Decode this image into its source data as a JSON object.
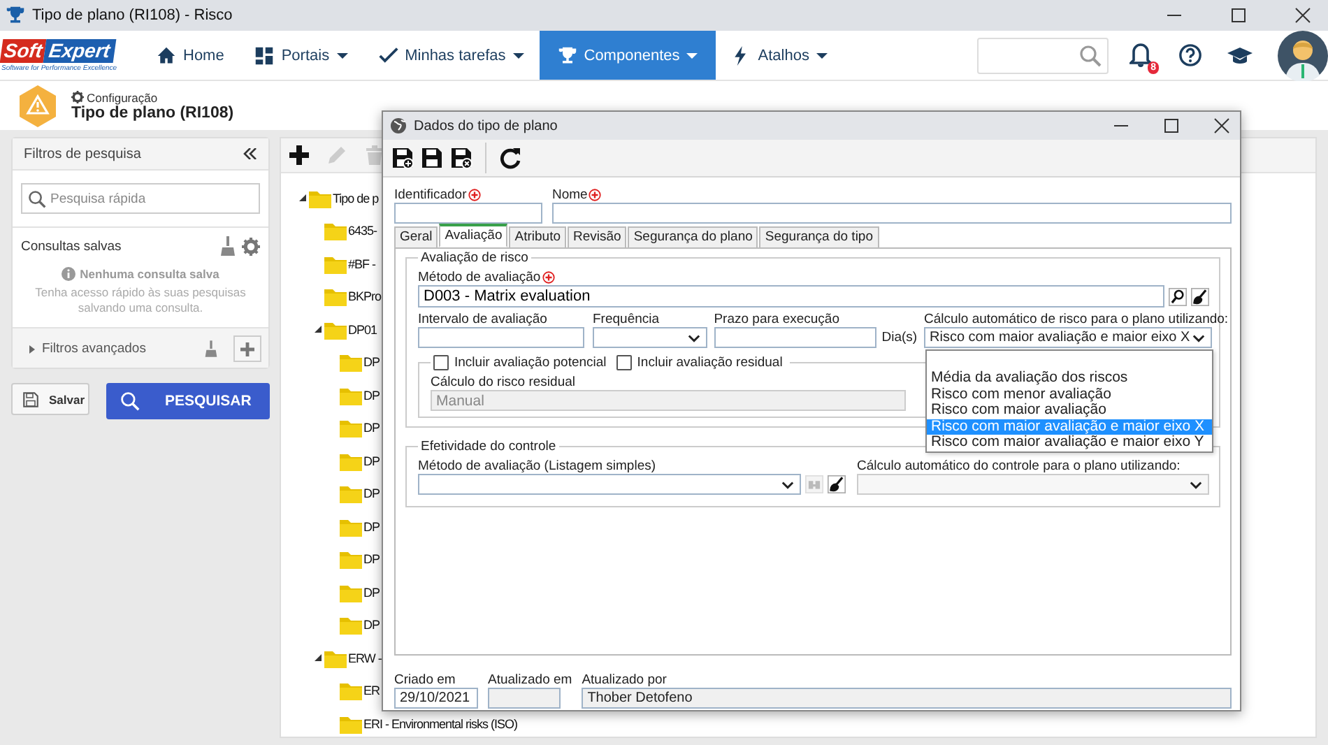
{
  "window": {
    "title": "Tipo de plano (RI108) - Risco"
  },
  "logo": {
    "brand_left": "Soft",
    "brand_right": "Expert",
    "tagline": "Software for Performance Excellence"
  },
  "nav": [
    {
      "label": "Home",
      "dropdown": false,
      "selected": false
    },
    {
      "label": "Portais",
      "dropdown": true,
      "selected": false
    },
    {
      "label": "Minhas tarefas",
      "dropdown": true,
      "selected": false
    },
    {
      "label": "Componentes",
      "dropdown": true,
      "selected": true
    },
    {
      "label": "Atalhos",
      "dropdown": true,
      "selected": false
    }
  ],
  "notifications": {
    "badge": "8"
  },
  "page_header": {
    "breadcrumb": "Configuração",
    "title": "Tipo de plano (RI108)"
  },
  "filters": {
    "title": "Filtros de pesquisa",
    "search_placeholder": "Pesquisa rápida",
    "saved_title": "Consultas salvas",
    "empty_title": "Nenhuma consulta salva",
    "empty_text": "Tenha acesso rápido às suas pesquisas salvando uma consulta.",
    "advanced": "Filtros avançados",
    "save_button": "Salvar",
    "search_button": "PESQUISAR"
  },
  "tree_toolbar": [
    {
      "kind": "add",
      "disabled": false
    },
    {
      "kind": "edit",
      "disabled": true
    },
    {
      "kind": "delete",
      "disabled": true
    }
  ],
  "tree": [
    {
      "label": "Tipo de p",
      "expanded": true,
      "children": [
        {
          "label": "6435-"
        },
        {
          "label": "#BF -"
        },
        {
          "label": "BKPro"
        },
        {
          "label": "DP01",
          "expanded": true,
          "children": [
            {
              "label": "DP"
            },
            {
              "label": "DP"
            },
            {
              "label": "DP"
            },
            {
              "label": "DP"
            },
            {
              "label": "DP"
            },
            {
              "label": "DP"
            },
            {
              "label": "DP"
            },
            {
              "label": "DP"
            },
            {
              "label": "DP"
            }
          ]
        },
        {
          "label": "ERW -",
          "expanded": true,
          "children": [
            {
              "label": "ER"
            },
            {
              "label": "ERI - Environmental risks (ISO)"
            }
          ]
        }
      ]
    }
  ],
  "dialog": {
    "title": "Dados do tipo de plano",
    "toolbar": [
      {
        "kind": "save-new"
      },
      {
        "kind": "save"
      },
      {
        "kind": "save-close"
      },
      {
        "kind": "refresh"
      }
    ],
    "identifier_label": "Identificador",
    "name_label": "Nome",
    "tabs": [
      {
        "label": "Geral",
        "selected": false
      },
      {
        "label": "Avaliação",
        "selected": true
      },
      {
        "label": "Atributo",
        "selected": false
      },
      {
        "label": "Revisão",
        "selected": false
      },
      {
        "label": "Segurança do plano",
        "selected": false
      },
      {
        "label": "Segurança do tipo",
        "selected": false
      }
    ],
    "risk_section": {
      "legend": "Avaliação de risco",
      "method_label": "Método de avaliação",
      "method_value": "D003 - Matrix evaluation",
      "interval_label": "Intervalo de avaliação",
      "frequency_label": "Frequência",
      "deadline_label": "Prazo para execução",
      "deadline_unit": "Dia(s)",
      "calc_label": "Cálculo automático de risco para o plano utilizando:",
      "calc_value": "Risco com maior avaliação e maior eixo X",
      "calc_options": [
        {
          "label": "Média da avaliação dos riscos",
          "selected": false
        },
        {
          "label": "Risco com menor avaliação",
          "selected": false
        },
        {
          "label": "Risco com maior avaliação",
          "selected": false
        },
        {
          "label": "Risco com maior avaliação e maior eixo X",
          "selected": true
        },
        {
          "label": "Risco com maior avaliação e maior eixo Y",
          "selected": false
        }
      ],
      "checkboxes": [
        {
          "label": "Incluir avaliação potencial",
          "checked": false
        },
        {
          "label": "Incluir avaliação residual",
          "checked": false
        }
      ],
      "residual_label": "Cálculo do risco residual",
      "residual_value": "Manual",
      "residual_disabled": true
    },
    "control_section": {
      "legend": "Efetividade do controle",
      "method_label": "Método de avaliação (Listagem simples)",
      "calc_label": "Cálculo automático do controle para o plano utilizando:"
    },
    "footer": [
      {
        "label": "Criado em",
        "value": "29/10/2021"
      },
      {
        "label": "Atualizado em"
      },
      {
        "label": "Atualizado por",
        "value": "Thober Detofeno"
      }
    ]
  }
}
